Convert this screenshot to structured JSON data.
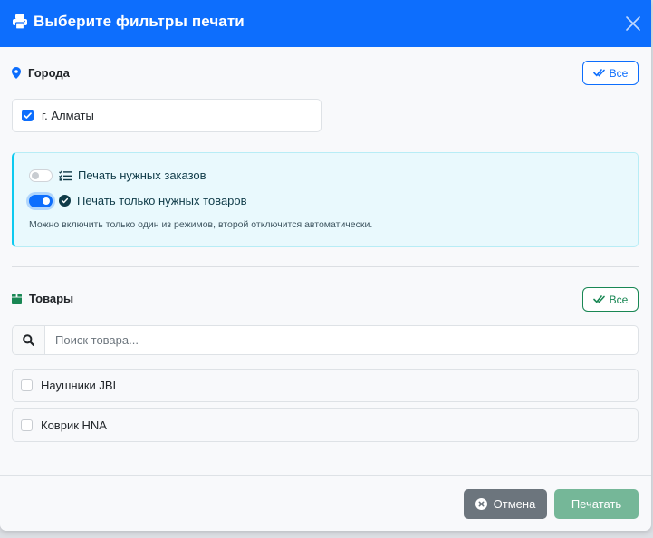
{
  "dialog": {
    "title": "Выберите фильтры печати",
    "header_icon": "printer-icon",
    "close_icon": "close-icon"
  },
  "cities": {
    "label": "Города",
    "icon": "map-marker-icon",
    "select_all_label": "Все",
    "items": [
      {
        "label": "г. Алматы",
        "checked": true
      }
    ]
  },
  "print_mode": {
    "options": [
      {
        "label": "Печать нужных заказов",
        "enabled": false,
        "icon": "list-check-icon"
      },
      {
        "label": "Печать только нужных товаров",
        "enabled": true,
        "icon": "check-circle-icon"
      }
    ],
    "note": "Можно включить только один из режимов, второй отключится автоматически."
  },
  "products": {
    "label": "Товары",
    "icon": "box-icon",
    "select_all_label": "Все",
    "search": {
      "placeholder": "Поиск товара...",
      "value": ""
    },
    "items": [
      {
        "label": "Наушники JBL",
        "checked": false
      },
      {
        "label": "Коврик HNA",
        "checked": false
      }
    ]
  },
  "footer": {
    "cancel_label": "Отмена",
    "print_label": "Печатать"
  },
  "colors": {
    "header": "#0d6efd",
    "primary": "#0d6efd",
    "success": "#198754",
    "info_border": "#0dcaf0",
    "secondary_button": "#6c757d",
    "print_button_disabled": "#75b798"
  }
}
